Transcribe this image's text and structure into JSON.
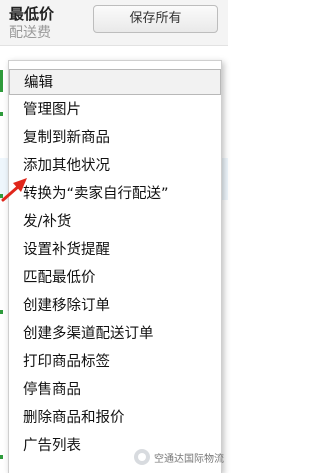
{
  "header": {
    "lowest_price": "最低价",
    "shipping_fee": "配送费",
    "save_all": "保存所有"
  },
  "menu": {
    "items": [
      {
        "label": "编辑"
      },
      {
        "label": "管理图片"
      },
      {
        "label": "复制到新商品"
      },
      {
        "label": "添加其他状况"
      },
      {
        "label": "转换为“卖家自行配送”"
      },
      {
        "label": "发/补货"
      },
      {
        "label": "设置补货提醒"
      },
      {
        "label": "匹配最低价"
      },
      {
        "label": "创建移除订单"
      },
      {
        "label": "创建多渠道配送订单"
      },
      {
        "label": "打印商品标签"
      },
      {
        "label": "停售商品"
      },
      {
        "label": "删除商品和报价"
      },
      {
        "label": "广告列表"
      }
    ]
  },
  "watermark": {
    "text": "空通达国际物流"
  },
  "colors": {
    "arrow": "#e0261b",
    "accent": "#2e9b3b"
  }
}
